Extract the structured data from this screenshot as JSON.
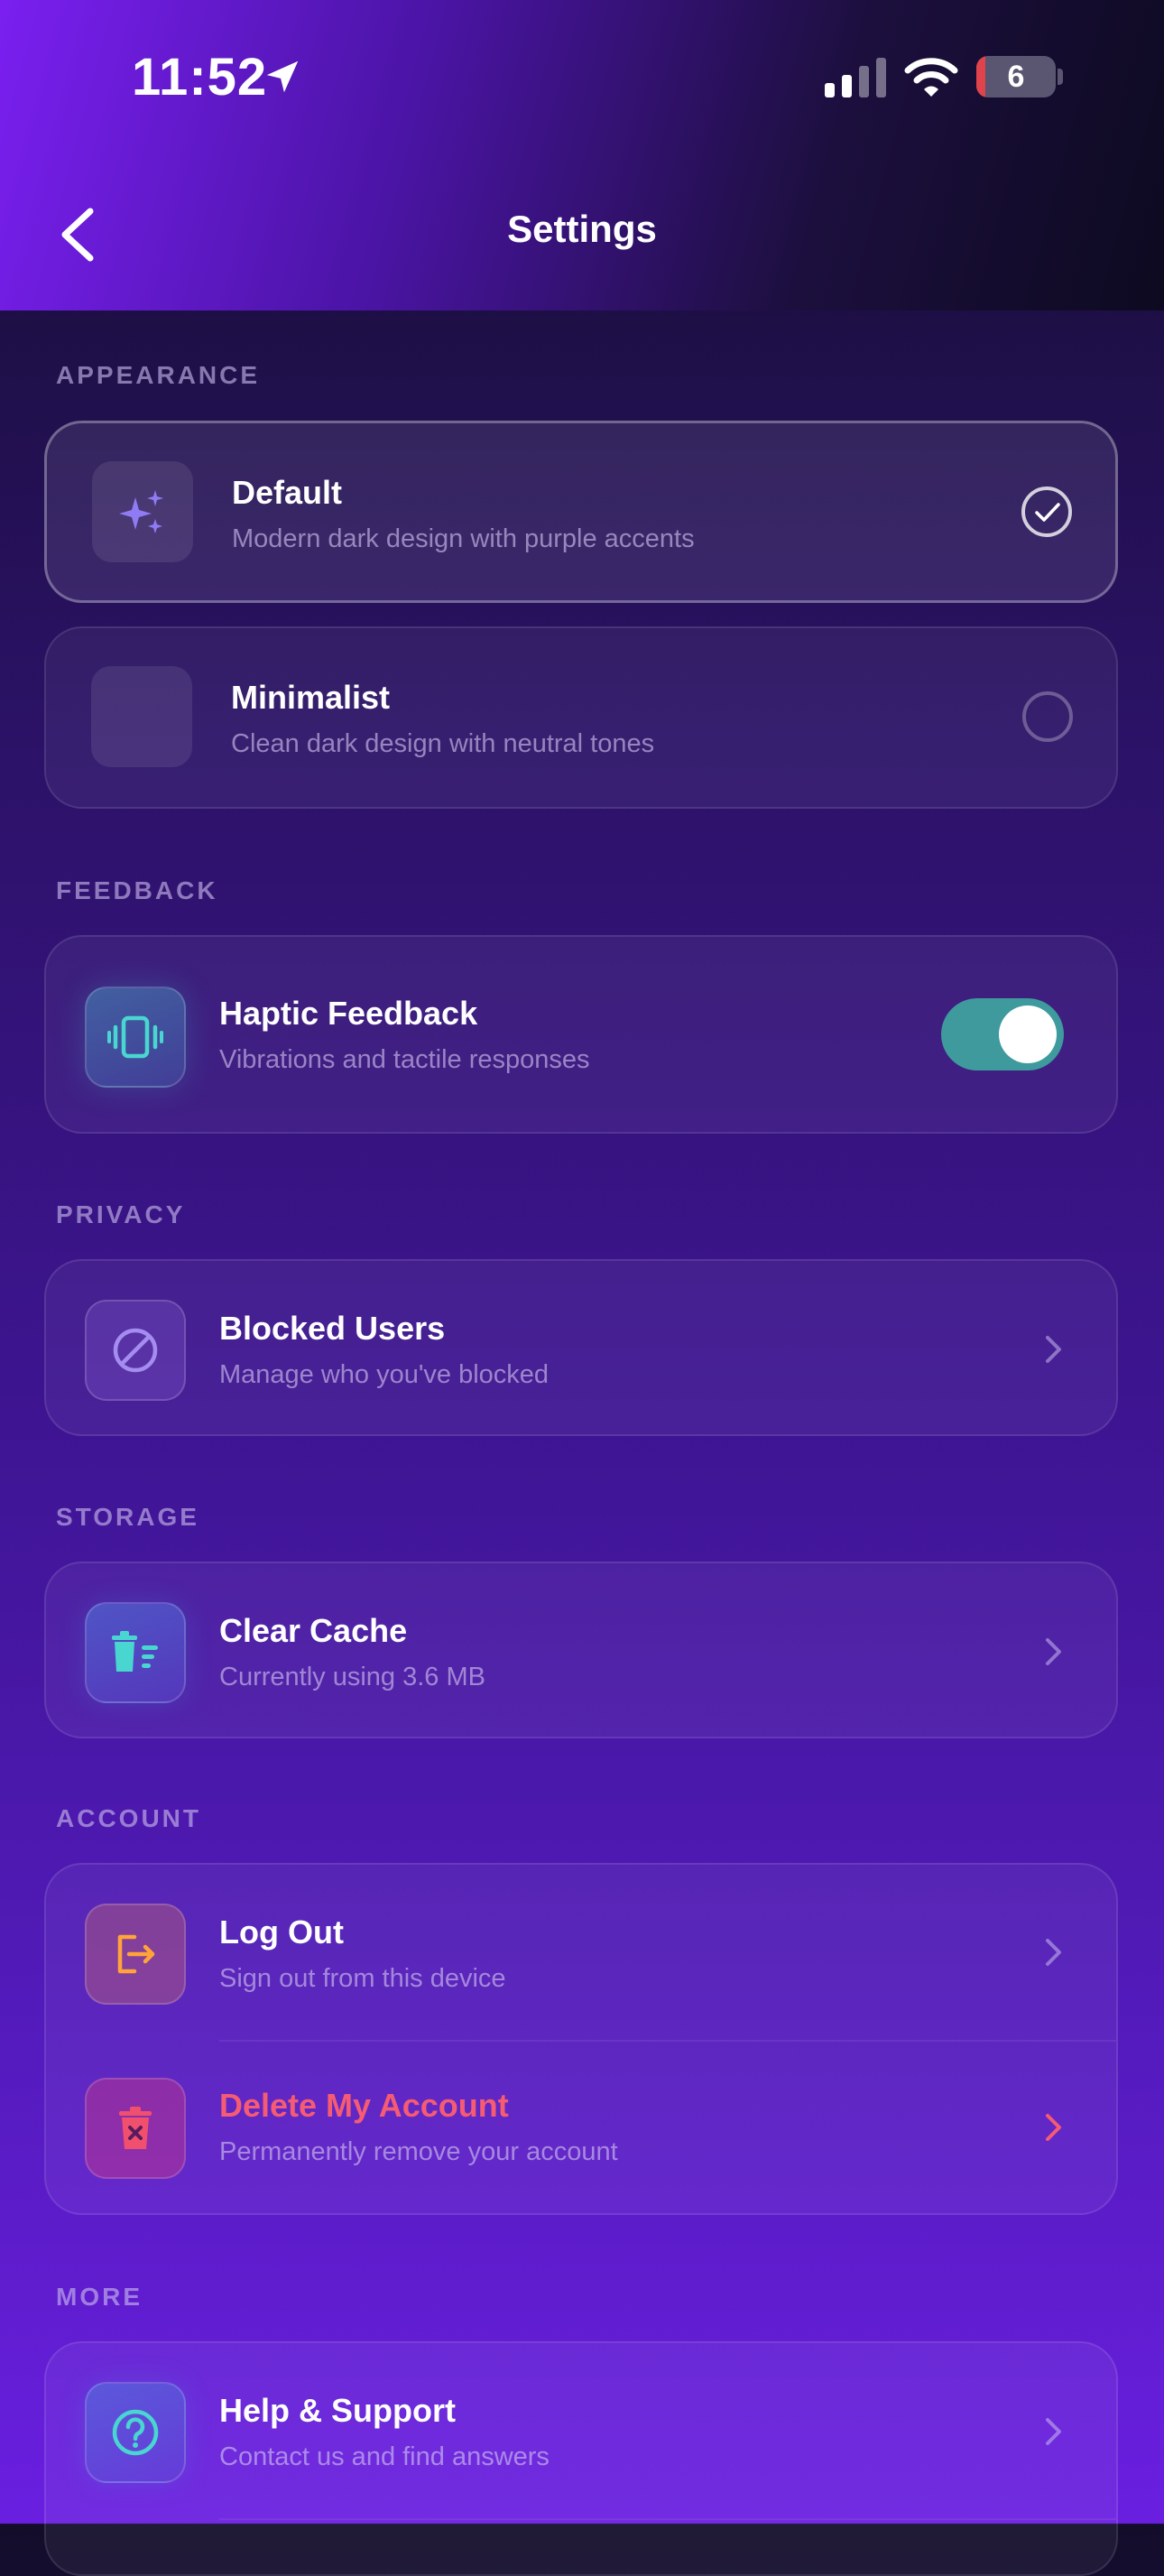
{
  "status_bar": {
    "time": "11:52",
    "battery_level": "6"
  },
  "nav": {
    "title": "Settings"
  },
  "appearance": {
    "label": "APPEARANCE",
    "options": [
      {
        "title": "Default",
        "subtitle": "Modern dark design with purple accents",
        "selected": true,
        "icon": "sparkles-icon"
      },
      {
        "title": "Minimalist",
        "subtitle": "Clean dark design with neutral tones",
        "selected": false,
        "icon": "moon-icon"
      }
    ]
  },
  "feedback": {
    "label": "FEEDBACK",
    "haptic": {
      "title": "Haptic Feedback",
      "subtitle": "Vibrations and tactile responses",
      "enabled": true,
      "icon": "vibration-icon"
    }
  },
  "privacy": {
    "label": "PRIVACY",
    "blocked": {
      "title": "Blocked Users",
      "subtitle": "Manage who you've blocked",
      "icon": "block-icon"
    }
  },
  "storage": {
    "label": "STORAGE",
    "cache": {
      "title": "Clear Cache",
      "subtitle": "Currently using 3.6 MB",
      "icon": "trash-icon"
    }
  },
  "account": {
    "label": "ACCOUNT",
    "logout": {
      "title": "Log Out",
      "subtitle": "Sign out from this device",
      "icon": "logout-icon"
    },
    "delete": {
      "title": "Delete My Account",
      "subtitle": "Permanently remove your account",
      "icon": "delete-icon"
    }
  },
  "more": {
    "label": "MORE",
    "help": {
      "title": "Help & Support",
      "subtitle": "Contact us and find answers",
      "icon": "help-icon"
    }
  },
  "colors": {
    "accent_toggle": "#3f9a9e",
    "danger": "#f55b73",
    "icon_teal": "#49d6d0",
    "icon_orange": "#ffa33a"
  }
}
